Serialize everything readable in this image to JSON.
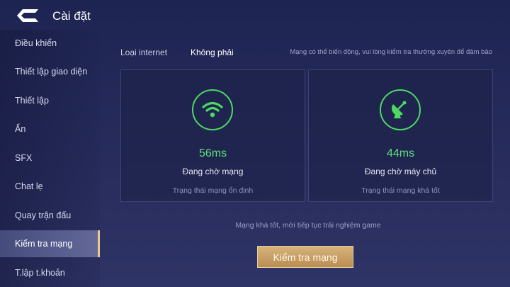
{
  "header": {
    "title": "Cài đặt",
    "back_icon": "back-arrow-icon"
  },
  "sidebar": {
    "items": [
      {
        "label": "Điều khiển"
      },
      {
        "label": "Thiết lập giao diện"
      },
      {
        "label": "Thiết lập"
      },
      {
        "label": "Ẩn"
      },
      {
        "label": "SFX"
      },
      {
        "label": "Chat lẹ"
      },
      {
        "label": "Quay trận đấu"
      },
      {
        "label": "Kiểm tra mạng",
        "active": true
      },
      {
        "label": "T.lập t.khoản"
      }
    ]
  },
  "network": {
    "type_label": "Loại internet",
    "type_value": "Không phải",
    "hint": "Mạng có thể biến động, vui lòng kiểm tra thường xuyên để đảm bảo"
  },
  "cards": [
    {
      "icon": "wifi-icon",
      "latency": "56ms",
      "status": "Đang chờ mạng",
      "substatus": "Trạng thái mạng ổn định"
    },
    {
      "icon": "satellite-dish-icon",
      "latency": "44ms",
      "status": "Đang chờ máy chủ",
      "substatus": "Trạng thái mạng khá tốt"
    }
  ],
  "summary": "Mạng khá tốt, mời tiếp tục trải nghiệm game",
  "check_button": {
    "label": "Kiểm tra mạng"
  },
  "colors": {
    "accent_green": "#4cd964",
    "button_gold": "#c9a267",
    "background": "#232859"
  }
}
